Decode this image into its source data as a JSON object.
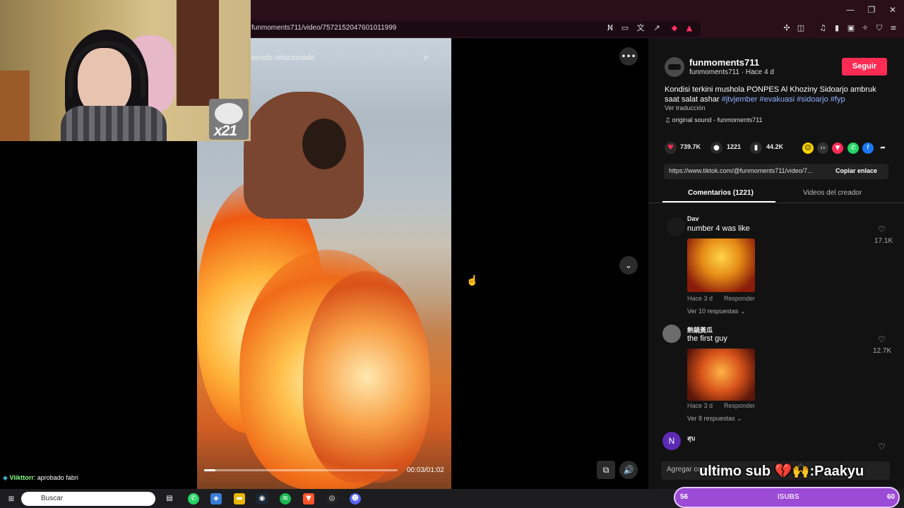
{
  "browser": {
    "url": "funmoments711/video/7572152047601011999",
    "window_controls": [
      "—",
      "❐",
      "✕"
    ]
  },
  "video": {
    "overlay_label": "tenido relacionado",
    "progress_fraction": 0.06,
    "time": "00:03/01:02"
  },
  "stream_overlay": {
    "cat_count": "x21",
    "bottom_text": "ultimo sub 💔🙌:Paakyu",
    "chat_user": "Viikttorr",
    "chat_message": ": aprobado fabri"
  },
  "post": {
    "username": "funmoments711",
    "sub_line": "funmoments711 · Hace 4 d",
    "follow_label": "Seguir",
    "caption_text": "Kondisi terkini mushola PONPES Al Khoziny Sidoarjo ambruk saat salat ashar ",
    "hashtags": "#jtvjember #evakuasi #sidoarjo #fyp",
    "translate_label": "Ver traducción",
    "sound": "original sound - funmoments711",
    "likes": "739.7K",
    "comments": "1221",
    "saves": "44.2K",
    "link": "https://www.tiktok.com/@funmoments711/video/7...",
    "copy_label": "Copiar enlace"
  },
  "tabs": {
    "comments": "Comentarios (1221)",
    "creator_videos": "Videos del creador"
  },
  "comments": [
    {
      "author": "Dav",
      "text": "number 4 was like",
      "meta": "Hace 3 d",
      "reply": "Responder",
      "replies": "Ver 10 respuestas",
      "likes": "17.1K"
    },
    {
      "author": "熱鍋黃瓜",
      "text": "the first guy",
      "meta": "Hace 3 d",
      "reply": "Responder",
      "replies": "Ver 8 respuestas",
      "likes": "12.7K"
    },
    {
      "author": "สุบ",
      "avatar_letter": "N"
    }
  ],
  "add_comment_placeholder": "Agregar comentario...",
  "taskbar": {
    "search_label": "Buscar"
  },
  "sub_goal": {
    "left": "56",
    "middle": "ISUBS",
    "right": "60"
  }
}
